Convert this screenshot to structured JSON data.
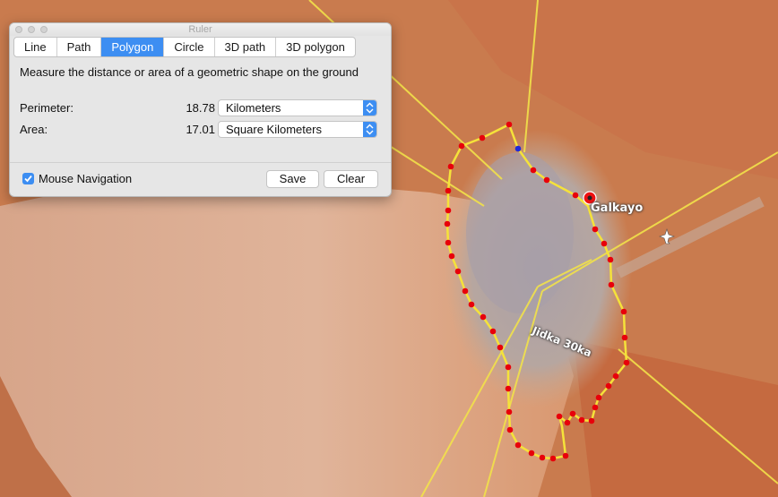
{
  "window": {
    "title": "Ruler"
  },
  "tabs": [
    {
      "label": "Line",
      "active": false
    },
    {
      "label": "Path",
      "active": false
    },
    {
      "label": "Polygon",
      "active": true
    },
    {
      "label": "Circle",
      "active": false
    },
    {
      "label": "3D path",
      "active": false
    },
    {
      "label": "3D polygon",
      "active": false
    }
  ],
  "description": "Measure the distance or area of a geometric shape on the ground",
  "perimeter": {
    "label": "Perimeter:",
    "value": "18.78",
    "unit": "Kilometers"
  },
  "area": {
    "label": "Area:",
    "value": "17.01",
    "unit": "Square Kilometers"
  },
  "mouse_navigation": {
    "label": "Mouse Navigation",
    "checked": true
  },
  "buttons": {
    "save": "Save",
    "clear": "Clear"
  },
  "map": {
    "place_label": "Galkayo",
    "road_label": "Jidka 30ka",
    "icons": [
      "place-pin-icon",
      "airport-icon"
    ]
  },
  "colors": {
    "accent": "#3d8ef2",
    "polygon_line": "#f5e23a",
    "vertex": "#e8000a",
    "selected_vertex": "#1f2ad8"
  }
}
